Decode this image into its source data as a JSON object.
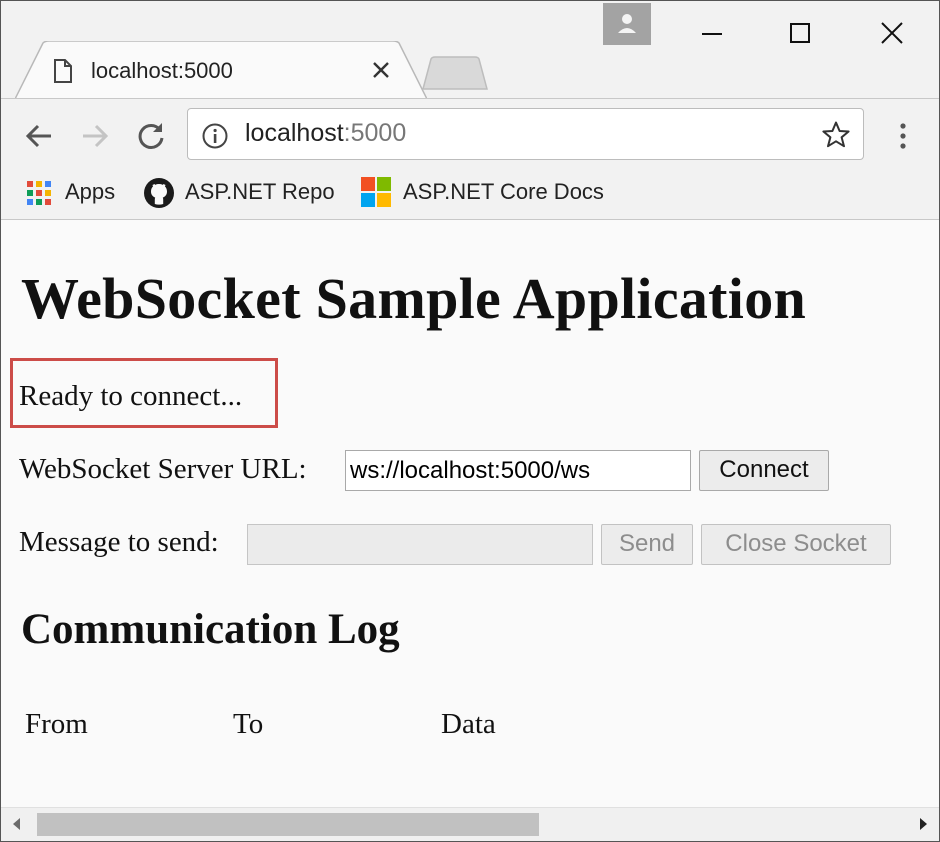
{
  "tab": {
    "title": "localhost:5000"
  },
  "address_bar": {
    "host": "localhost",
    "port": ":5000"
  },
  "bookmarks": [
    {
      "label": "Apps",
      "icon": "apps-grid-icon"
    },
    {
      "label": "ASP.NET Repo",
      "icon": "github-icon"
    },
    {
      "label": "ASP.NET Core Docs",
      "icon": "windows-logo-icon"
    }
  ],
  "page": {
    "heading": "WebSocket Sample Application",
    "status": "Ready to connect...",
    "url_label": "WebSocket Server URL:",
    "url_value": "ws://localhost:5000/ws",
    "connect_label": "Connect",
    "message_label": "Message to send:",
    "message_value": "",
    "send_label": "Send",
    "close_label": "Close Socket",
    "log_heading": "Communication Log",
    "log_columns": [
      "From",
      "To",
      "Data"
    ]
  },
  "colors": {
    "highlight_border": "#cc4c48",
    "chrome_bg": "#f2f2f2",
    "page_bg": "#fafafa"
  }
}
